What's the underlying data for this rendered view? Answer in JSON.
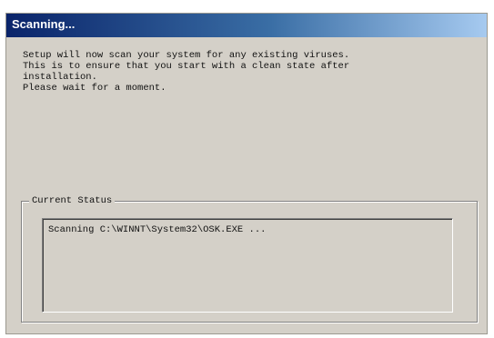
{
  "window": {
    "title": "Scanning..."
  },
  "message": {
    "lines": [
      "Setup will now scan your system for any existing viruses.",
      "This is to ensure that you start with a clean state after",
      "installation.",
      "Please wait for a moment."
    ]
  },
  "status_group": {
    "label": "Current Status",
    "status_text": "Scanning C:\\WINNT\\System32\\OSK.EXE ..."
  }
}
